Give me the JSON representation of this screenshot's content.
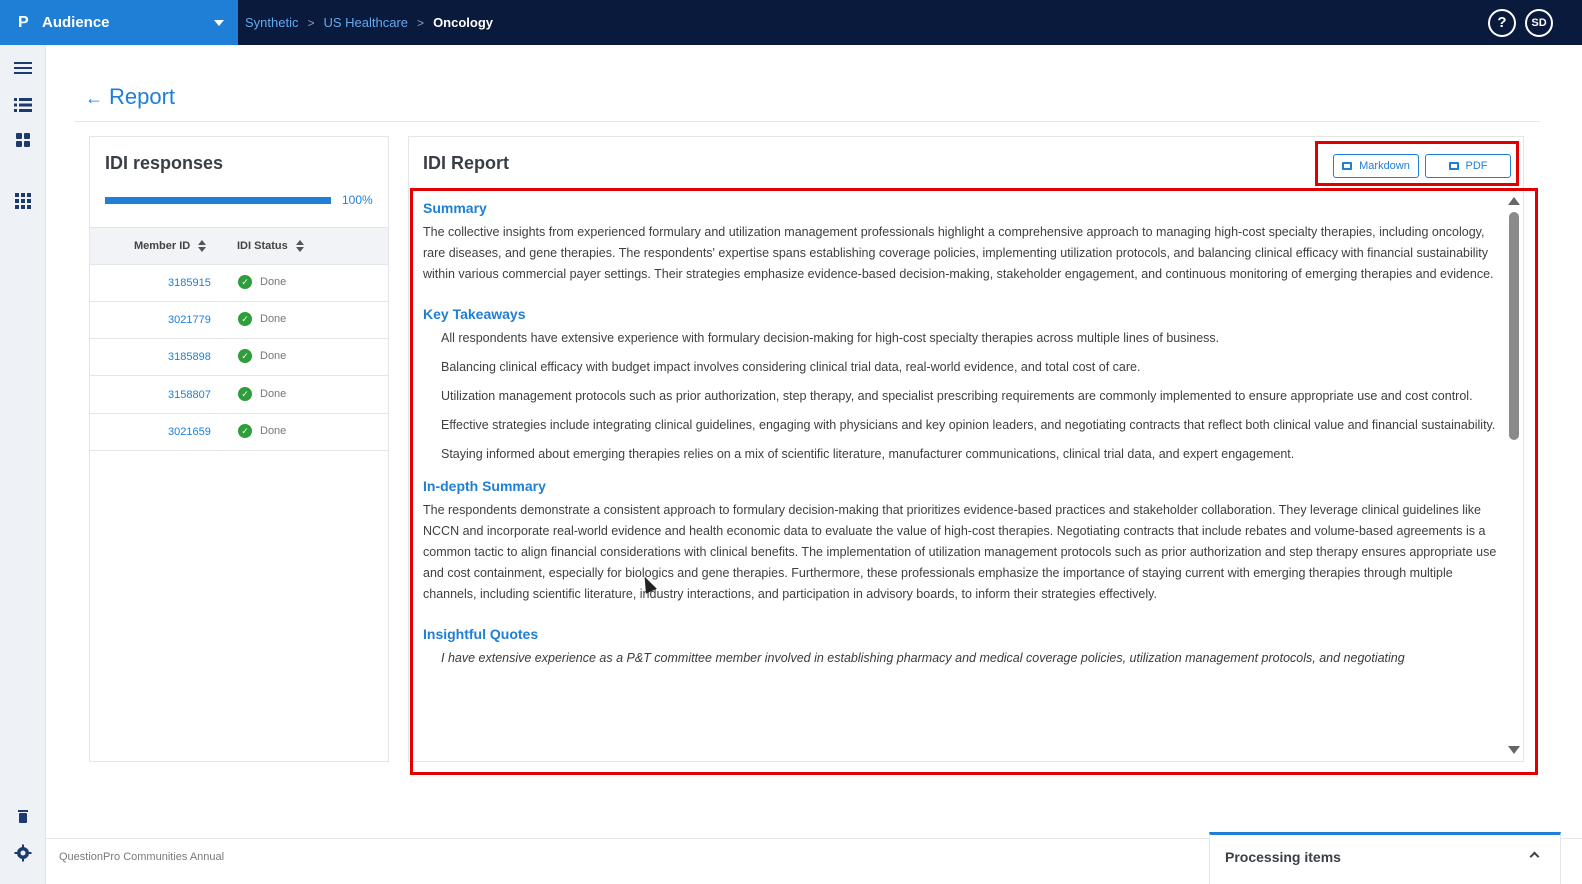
{
  "app": {
    "name": "Audience",
    "logo_glyph": "P"
  },
  "breadcrumb": {
    "items": [
      "Synthetic",
      "US Healthcare"
    ],
    "current": "Oncology",
    "separator": ">"
  },
  "header_right": {
    "help": "?",
    "avatar_initials": "SD"
  },
  "page": {
    "back_glyph": "←",
    "title": "Report"
  },
  "responses": {
    "title": "IDI responses",
    "progress_percent": 100,
    "progress_label": "100%",
    "columns": [
      "Member ID",
      "IDI Status"
    ],
    "rows": [
      {
        "id": "3185915",
        "status": "Done"
      },
      {
        "id": "3021779",
        "status": "Done"
      },
      {
        "id": "3185898",
        "status": "Done"
      },
      {
        "id": "3158807",
        "status": "Done"
      },
      {
        "id": "3021659",
        "status": "Done"
      }
    ]
  },
  "report": {
    "title": "IDI Report",
    "export": {
      "markdown_label": "Markdown",
      "pdf_label": "PDF"
    },
    "summary_title": "Summary",
    "summary_text": "The collective insights from experienced formulary and utilization management professionals highlight a comprehensive approach to managing high-cost specialty therapies, including oncology, rare diseases, and gene therapies. The respondents' expertise spans establishing coverage policies, implementing utilization protocols, and balancing clinical efficacy with financial sustainability within various commercial payer settings. Their strategies emphasize evidence-based decision-making, stakeholder engagement, and continuous monitoring of emerging therapies and evidence.",
    "takeaways_title": "Key Takeaways",
    "takeaways": [
      "All respondents have extensive experience with formulary decision-making for high-cost specialty therapies across multiple lines of business.",
      "Balancing clinical efficacy with budget impact involves considering clinical trial data, real-world evidence, and total cost of care.",
      "Utilization management protocols such as prior authorization, step therapy, and specialist prescribing requirements are commonly implemented to ensure appropriate use and cost control.",
      "Effective strategies include integrating clinical guidelines, engaging with physicians and key opinion leaders, and negotiating contracts that reflect both clinical value and financial sustainability.",
      "Staying informed about emerging therapies relies on a mix of scientific literature, manufacturer communications, clinical trial data, and expert engagement."
    ],
    "indepth_title": "In-depth Summary",
    "indepth_text": "The respondents demonstrate a consistent approach to formulary decision-making that prioritizes evidence-based practices and stakeholder collaboration. They leverage clinical guidelines like NCCN and incorporate real-world evidence and health economic data to evaluate the value of high-cost therapies. Negotiating contracts that include rebates and volume-based agreements is a common tactic to align financial considerations with clinical benefits. The implementation of utilization management protocols such as prior authorization and step therapy ensures appropriate use and cost containment, especially for biologics and gene therapies. Furthermore, these professionals emphasize the importance of staying current with emerging therapies through multiple channels, including scientific literature, industry interactions, and participation in advisory boards, to inform their strategies effectively.",
    "quotes_title": "Insightful Quotes",
    "quote_first": "I have extensive experience as a P&T committee member involved in establishing pharmacy and medical coverage policies, utilization management protocols, and negotiating"
  },
  "footer": {
    "text": "QuestionPro Communities Annual",
    "processing_label": "Processing items"
  },
  "colors": {
    "navy": "#0a1a3c",
    "accent": "#1f7fd6",
    "highlight": "#e00000",
    "success": "#2e9e3a"
  }
}
